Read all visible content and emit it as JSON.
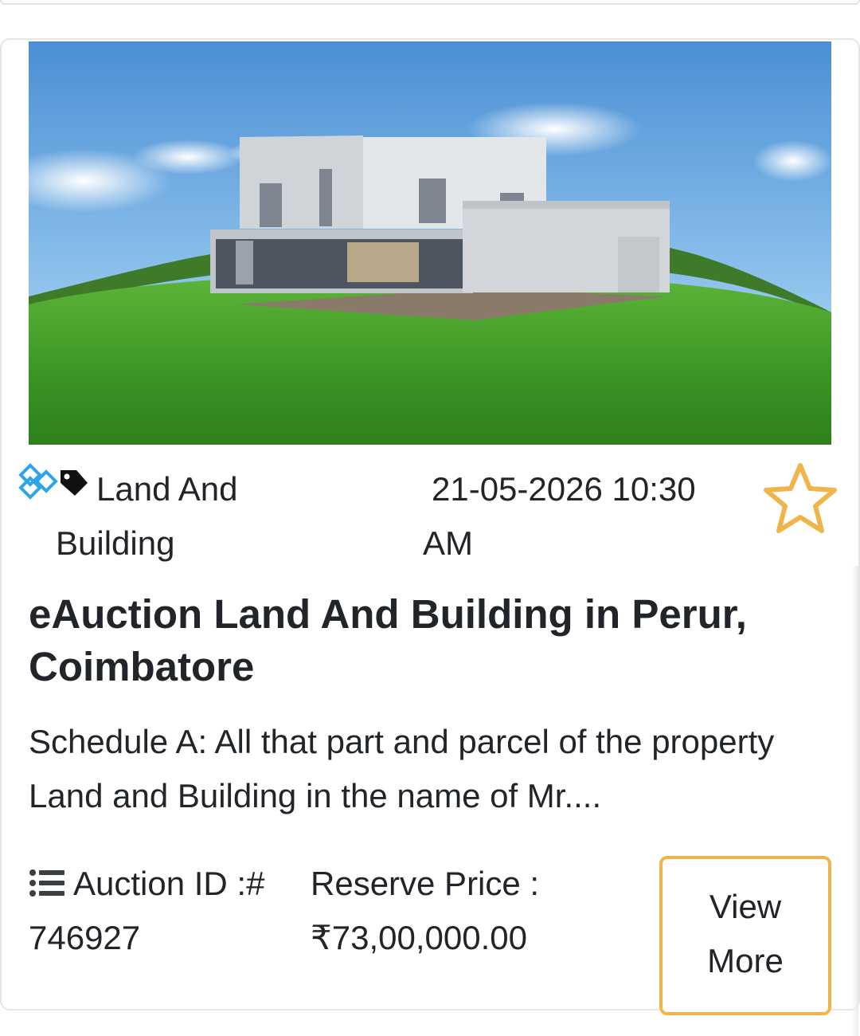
{
  "listing": {
    "category_line1": "Land And",
    "category_line2": "Building",
    "date_line1": "21-05-2026 10:30",
    "date_line2": "AM",
    "title": "eAuction Land And Building in Perur, Coimbatore",
    "description_line1": "Schedule A: All that part and parcel of the property",
    "description_line2": "Land and Building in the name of Mr....",
    "auction_id_label": "Auction ID :#",
    "auction_id_value": "746927",
    "reserve_price_label": "Reserve Price :",
    "reserve_price_value": "₹73,00,000.00",
    "view_more_line1": "View",
    "view_more_line2": "More"
  },
  "icons": {
    "category": "category-tag-icon",
    "favorite": "star-outline-icon",
    "auction_id": "list-icon"
  },
  "colors": {
    "accent_orange": "#f0b54a",
    "icon_blue": "#2fa4e7",
    "text": "#212529"
  }
}
